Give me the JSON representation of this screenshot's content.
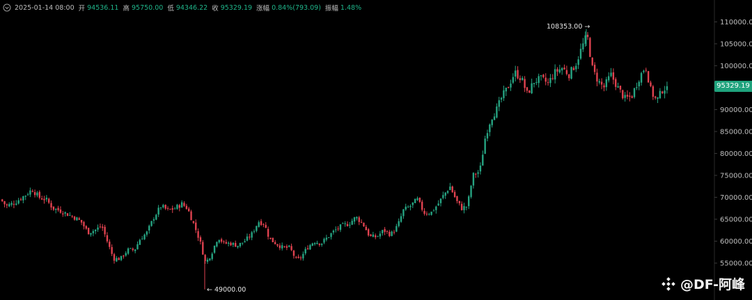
{
  "ohlc": {
    "date": "2025-01-14 08:00",
    "open_label": "开",
    "open": "94536.11",
    "high_label": "高",
    "high": "95750.00",
    "low_label": "低",
    "low": "94346.22",
    "close_label": "收",
    "close": "95329.19",
    "change_label": "涨幅",
    "change": "0.84%(793.09)",
    "amplitude_label": "振幅",
    "amplitude": "1.48%"
  },
  "last_price": "95329.19",
  "watermark": "@DF-阿峰",
  "colors": {
    "up": "#26a482",
    "down": "#e0424f",
    "tag": "#1fa37d",
    "text": "#bfbfbf"
  },
  "chart_data": {
    "type": "candlestick",
    "ylim": [
      51000,
      113500
    ],
    "yticks": [
      "55000.00",
      "60000.00",
      "65000.00",
      "70000.00",
      "75000.00",
      "80000.00",
      "85000.00",
      "90000.00",
      "95000.00",
      "100000.00",
      "105000.00",
      "110000.00"
    ],
    "annotations": [
      {
        "text": "108353.00 →",
        "value": 108353
      },
      {
        "text": "← 49000.00",
        "value": 49000
      }
    ],
    "approx_close_path": [
      [
        0,
        69500
      ],
      [
        8,
        68000
      ],
      [
        20,
        68800
      ],
      [
        35,
        70500
      ],
      [
        45,
        71800
      ],
      [
        55,
        70000
      ],
      [
        65,
        69500
      ],
      [
        75,
        67500
      ],
      [
        85,
        67000
      ],
      [
        95,
        66200
      ],
      [
        105,
        65500
      ],
      [
        115,
        64500
      ],
      [
        125,
        62000
      ],
      [
        135,
        62500
      ],
      [
        145,
        63500
      ],
      [
        155,
        59000
      ],
      [
        162,
        56000
      ],
      [
        172,
        56000
      ],
      [
        182,
        58000
      ],
      [
        192,
        58000
      ],
      [
        200,
        60500
      ],
      [
        210,
        62000
      ],
      [
        220,
        65500
      ],
      [
        230,
        68000
      ],
      [
        240,
        67000
      ],
      [
        250,
        67500
      ],
      [
        260,
        68500
      ],
      [
        268,
        67500
      ],
      [
        278,
        63500
      ],
      [
        286,
        60000
      ],
      [
        294,
        55000
      ],
      [
        302,
        57000
      ],
      [
        312,
        61000
      ],
      [
        320,
        59500
      ],
      [
        330,
        59500
      ],
      [
        340,
        59000
      ],
      [
        350,
        60000
      ],
      [
        360,
        61500
      ],
      [
        370,
        64500
      ],
      [
        378,
        64000
      ],
      [
        386,
        60500
      ],
      [
        395,
        59500
      ],
      [
        405,
        58500
      ],
      [
        415,
        58500
      ],
      [
        425,
        55500
      ],
      [
        432,
        56500
      ],
      [
        440,
        58500
      ],
      [
        450,
        60000
      ],
      [
        460,
        59500
      ],
      [
        470,
        61000
      ],
      [
        480,
        62500
      ],
      [
        490,
        63500
      ],
      [
        500,
        64000
      ],
      [
        510,
        65500
      ],
      [
        520,
        64000
      ],
      [
        530,
        61000
      ],
      [
        540,
        61000
      ],
      [
        550,
        62500
      ],
      [
        560,
        61500
      ],
      [
        570,
        63500
      ],
      [
        578,
        67000
      ],
      [
        588,
        68000
      ],
      [
        598,
        69500
      ],
      [
        608,
        66500
      ],
      [
        618,
        66500
      ],
      [
        628,
        68500
      ],
      [
        636,
        70500
      ],
      [
        645,
        72500
      ],
      [
        655,
        69000
      ],
      [
        662,
        67500
      ],
      [
        670,
        68000
      ],
      [
        678,
        75000
      ],
      [
        688,
        76000
      ],
      [
        696,
        84000
      ],
      [
        704,
        88000
      ],
      [
        712,
        90000
      ],
      [
        720,
        93000
      ],
      [
        728,
        95000
      ],
      [
        738,
        98500
      ],
      [
        748,
        97000
      ],
      [
        756,
        93500
      ],
      [
        766,
        96500
      ],
      [
        776,
        97000
      ],
      [
        786,
        96000
      ],
      [
        796,
        98500
      ],
      [
        806,
        99500
      ],
      [
        816,
        98000
      ],
      [
        826,
        100500
      ],
      [
        834,
        104000
      ],
      [
        842,
        107000
      ],
      [
        850,
        99000
      ],
      [
        858,
        96500
      ],
      [
        866,
        95000
      ],
      [
        876,
        98000
      ],
      [
        886,
        95000
      ],
      [
        896,
        92500
      ],
      [
        906,
        93000
      ],
      [
        916,
        97000
      ],
      [
        926,
        100000
      ],
      [
        934,
        94000
      ],
      [
        942,
        92000
      ],
      [
        950,
        94500
      ],
      [
        958,
        95329
      ]
    ]
  }
}
